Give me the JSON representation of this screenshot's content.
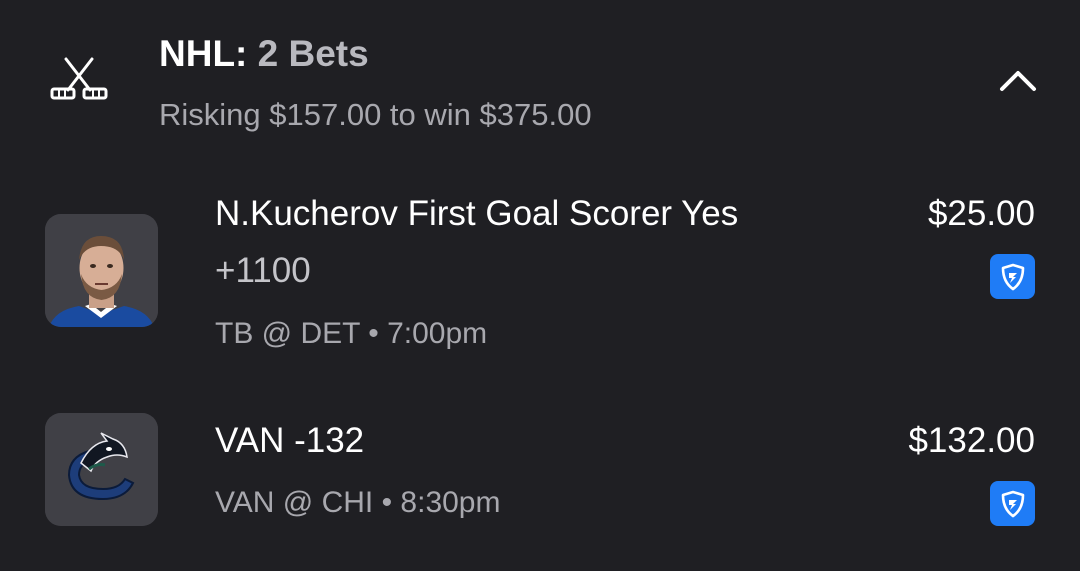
{
  "header": {
    "sport_label": "NHL:",
    "bet_count_label": "2 Bets",
    "summary": "Risking $157.00 to win $375.00",
    "icon": "hockey-sticks-icon",
    "collapse_icon": "chevron-up-icon"
  },
  "bets": [
    {
      "title": "N.Kucherov First Goal Scorer Yes",
      "odds": "+1100",
      "matchup": "TB @ DET • 7:00pm",
      "amount": "$25.00",
      "thumb_icon": "player-headshot",
      "book_icon": "fanduel-shield-icon"
    },
    {
      "title": "VAN -132",
      "matchup": "VAN @ CHI • 8:30pm",
      "amount": "$132.00",
      "thumb_icon": "canucks-logo",
      "book_icon": "fanduel-shield-icon"
    }
  ],
  "colors": {
    "background": "#1f1f23",
    "thumb_bg": "#3a3a40",
    "book_blue": "#1f7cf6",
    "muted_text": "#a8a8ae"
  }
}
